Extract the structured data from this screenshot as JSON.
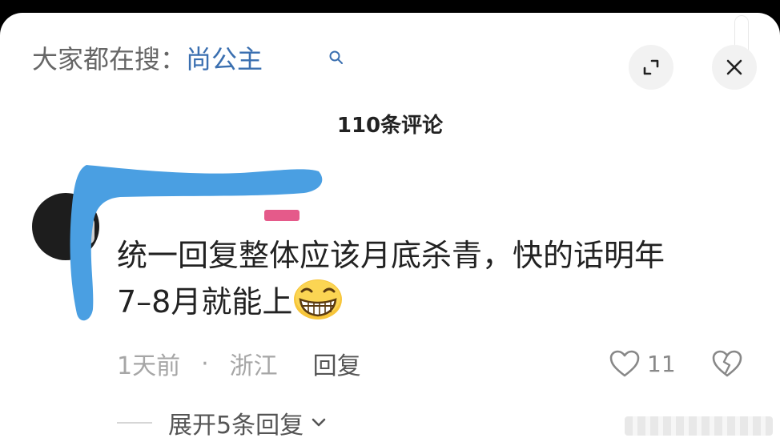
{
  "header": {
    "search_prefix": "大家都在搜：",
    "search_term": "尚公主"
  },
  "comments_title": "110条评论",
  "comment": {
    "line1": "统一回复整体应该月底杀青，快的话明年",
    "line2": "7–8月就能上",
    "time": "1天前",
    "separator": "·",
    "location": "浙江",
    "reply_label": "回复",
    "like_count": "11"
  },
  "replies": {
    "expand_label": "展开5条回复"
  },
  "icons": {
    "search": "search-icon",
    "expand": "expand-icon",
    "close": "close-icon",
    "like": "heart-icon",
    "dislike": "broken-heart-icon",
    "chevron": "chevron-down-icon",
    "emoji": "grinning-emoji-icon"
  },
  "colors": {
    "search_term": "#3a6fb0",
    "scribble": "#4a9fe2"
  }
}
